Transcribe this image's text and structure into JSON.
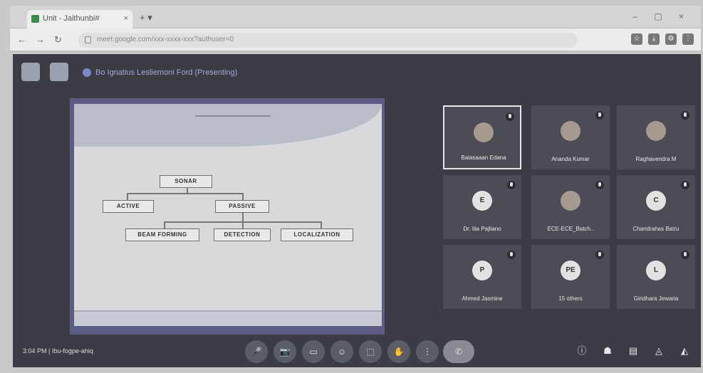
{
  "browser": {
    "tab_title": "Unit - Jaithunbi#",
    "tab_close": "×",
    "new_tab": "+ ▾",
    "window_controls": "– ▢ ×",
    "url": "meet.google.com/xxx-xxxx-xxx?authuser=0",
    "toolbar_icons": [
      "☆",
      "⤓",
      "⚙",
      "⋮"
    ]
  },
  "meeting": {
    "header_title": "Bo Ignatius Lesliemoni Ford (Presenting)",
    "clock": "3:04 PM | Ibu-fogpe-ahiq",
    "slide": {
      "root": "SONAR",
      "level1": [
        "ACTIVE",
        "PASSIVE"
      ],
      "level2": [
        "BEAM FORMING",
        "DETECTION",
        "LOCALIZATION"
      ]
    },
    "participants": [
      {
        "name": "Balasaaan Edana",
        "initial": "",
        "photo": true,
        "active": true
      },
      {
        "name": "Ananda Kumar",
        "initial": "",
        "photo": true
      },
      {
        "name": "Raghavendra M",
        "initial": "",
        "photo": true
      },
      {
        "name": "Dr. Ilia Pajliano",
        "initial": "E",
        "photo": false
      },
      {
        "name": "ECE-ECE_Batch..",
        "initial": "",
        "photo": true
      },
      {
        "name": "Chandrahas Batru",
        "initial": "C",
        "photo": false
      },
      {
        "name": "Ahmed Jasmine",
        "initial": "P",
        "photo": false
      },
      {
        "name": "15 others",
        "initial": "PE",
        "photo": false
      },
      {
        "name": "Giridhara Jewaria",
        "initial": "L",
        "photo": false
      }
    ],
    "controls": [
      "🎤",
      "📷",
      "▭",
      "☺",
      "⬚",
      "✋",
      "⋮",
      "✆"
    ],
    "right_controls": [
      "ⓘ",
      "☗",
      "▤",
      "◬",
      "◭"
    ]
  }
}
